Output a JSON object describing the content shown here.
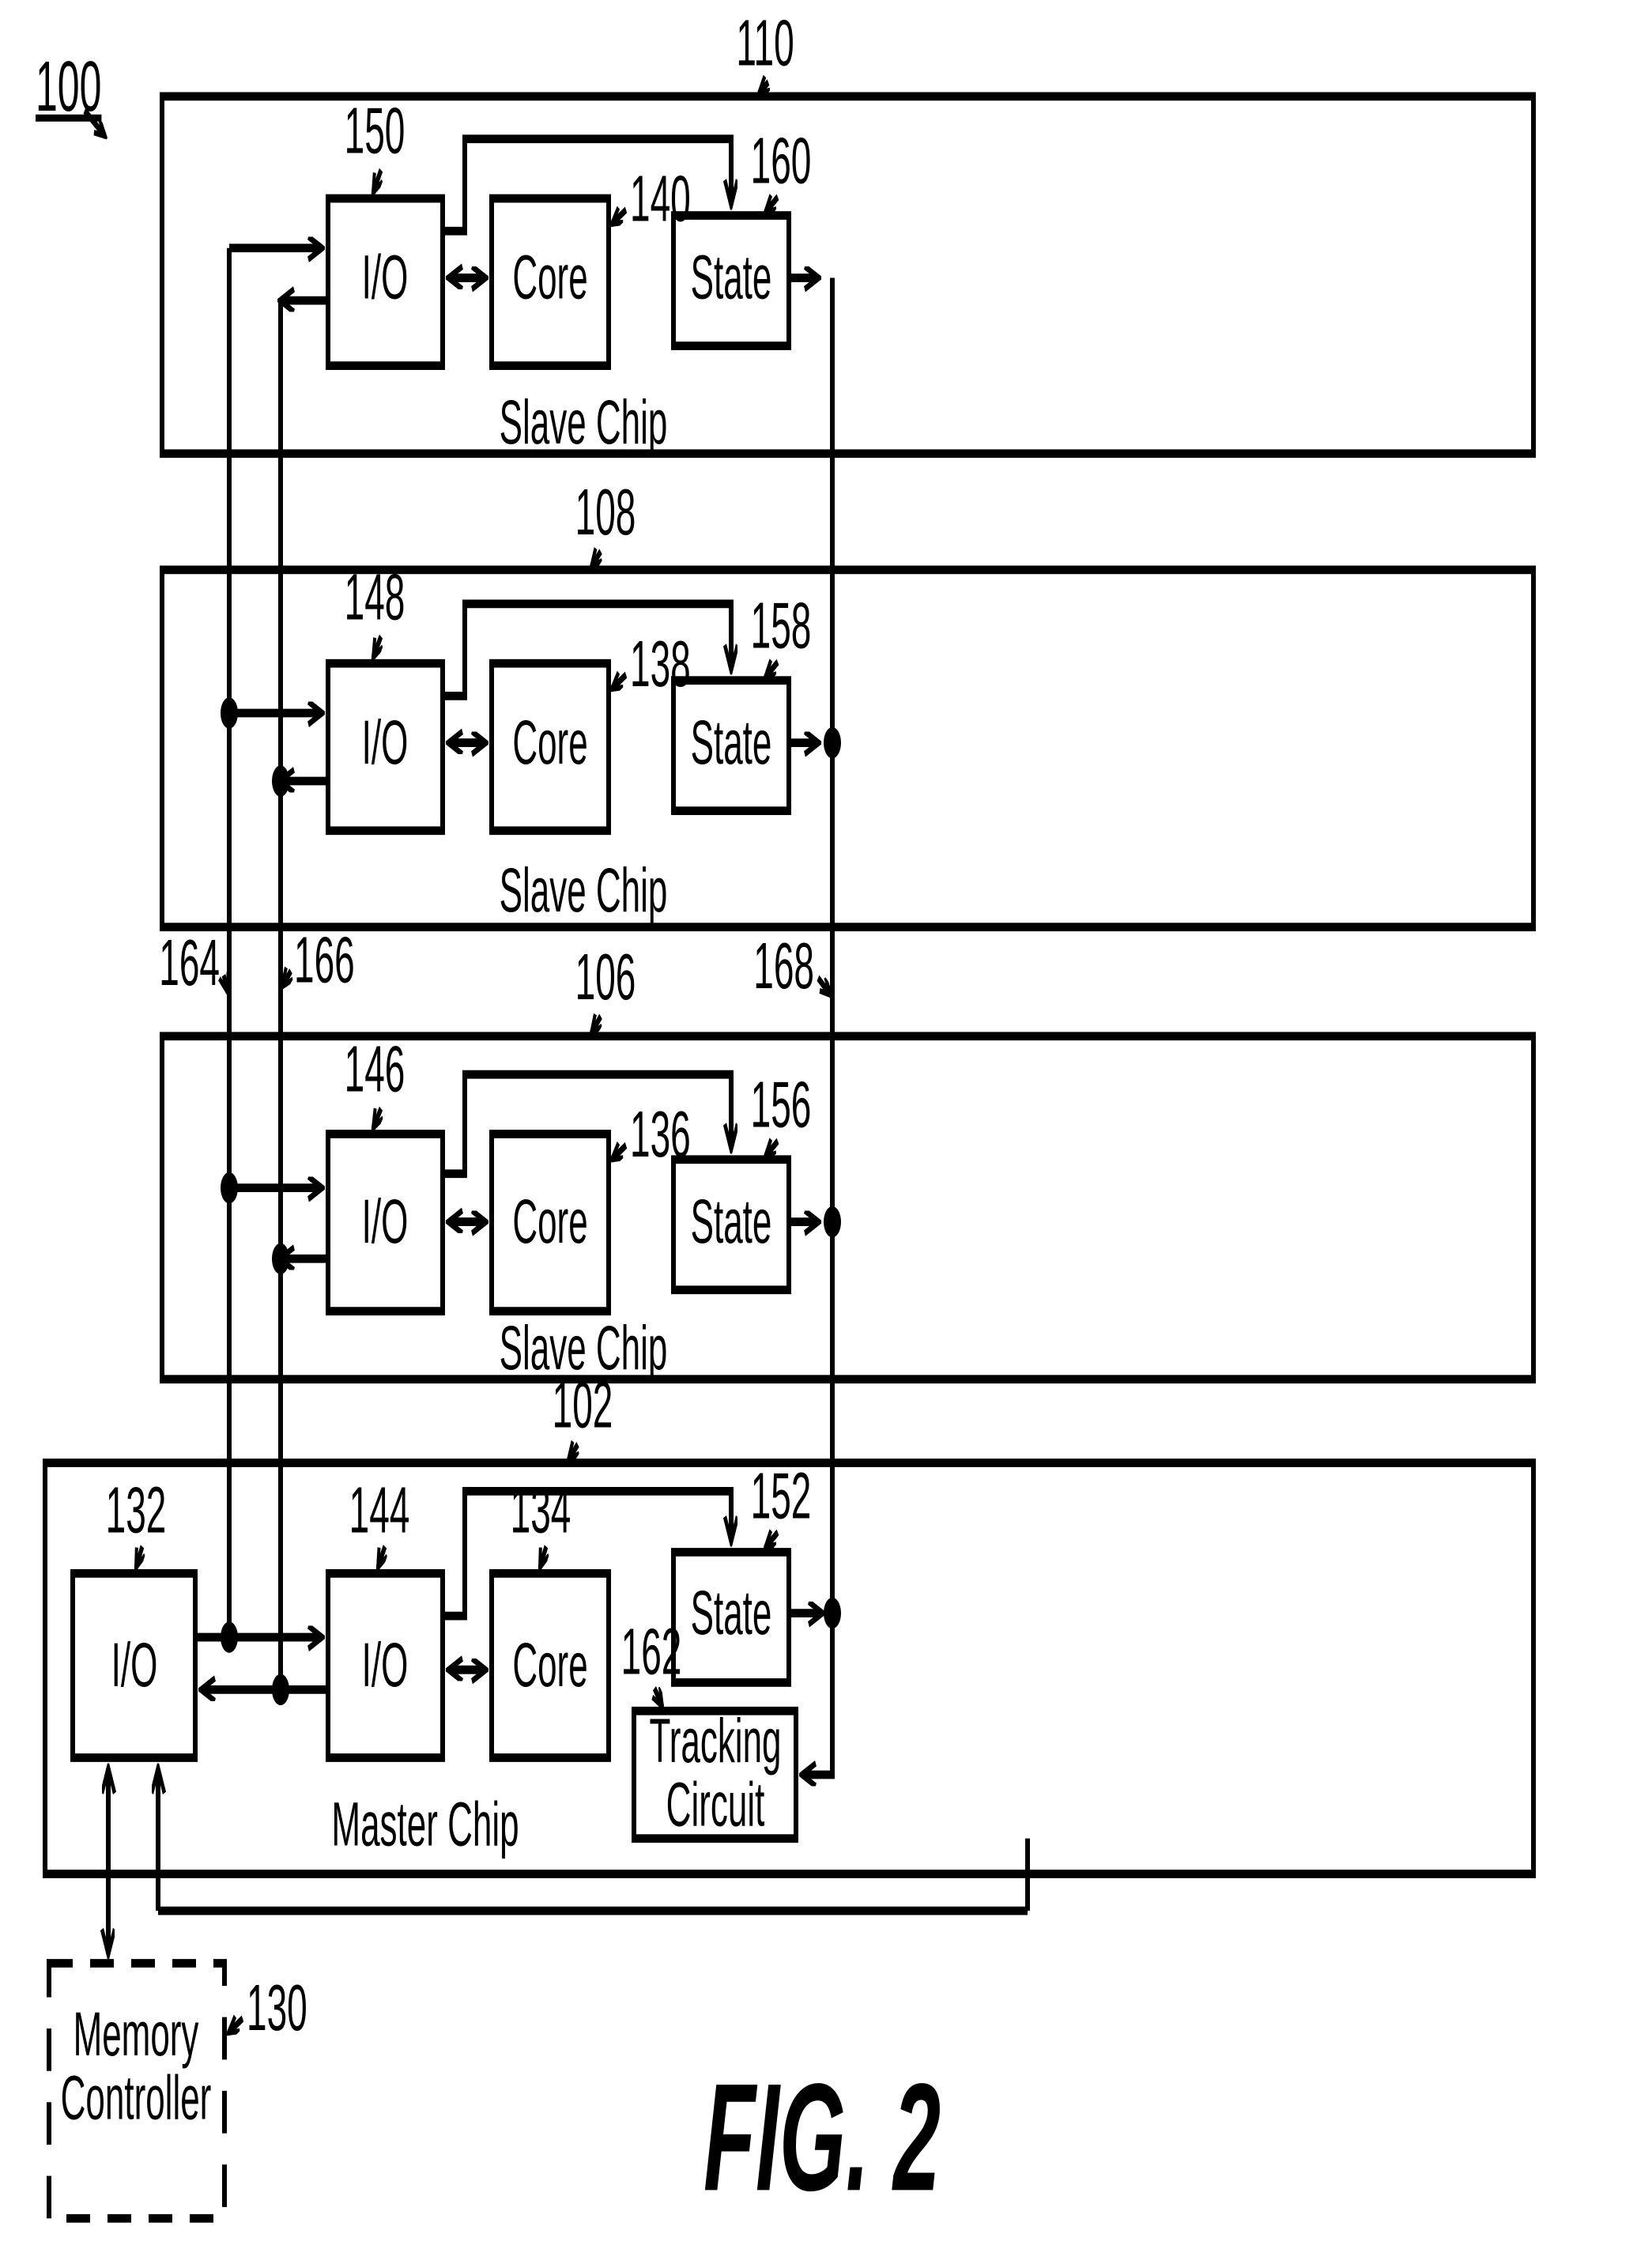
{
  "figure": {
    "caption": "FIG. 2",
    "system_ref": "100"
  },
  "chips": [
    {
      "id": "slave-top",
      "name": "Slave Chip",
      "ref": "110",
      "blocks": [
        {
          "name": "io",
          "label": "I/O",
          "ref": "150"
        },
        {
          "name": "core",
          "label": "Core",
          "ref": "140"
        },
        {
          "name": "state",
          "label": "State",
          "ref": "160"
        }
      ]
    },
    {
      "id": "slave-mid-upper",
      "name": "Slave Chip",
      "ref": "108",
      "blocks": [
        {
          "name": "io",
          "label": "I/O",
          "ref": "148"
        },
        {
          "name": "core",
          "label": "Core",
          "ref": "138"
        },
        {
          "name": "state",
          "label": "State",
          "ref": "158"
        }
      ]
    },
    {
      "id": "slave-mid-lower",
      "name": "Slave Chip",
      "ref": "106",
      "blocks": [
        {
          "name": "io",
          "label": "I/O",
          "ref": "146"
        },
        {
          "name": "core",
          "label": "Core",
          "ref": "136"
        },
        {
          "name": "state",
          "label": "State",
          "ref": "156"
        }
      ]
    },
    {
      "id": "master",
      "name": "Master Chip",
      "ref": "102",
      "blocks": [
        {
          "name": "io-external",
          "label": "I/O",
          "ref": "132"
        },
        {
          "name": "io-internal",
          "label": "I/O",
          "ref": "144"
        },
        {
          "name": "core",
          "label": "Core",
          "ref": "134"
        },
        {
          "name": "state",
          "label": "State",
          "ref": "152"
        },
        {
          "name": "tracking-circuit",
          "label_line1": "Tracking",
          "label_line2": "Circuit",
          "ref": "162"
        }
      ]
    }
  ],
  "external": {
    "memory_controller": {
      "label_line1": "Memory",
      "label_line2": "Controller",
      "ref": "130"
    }
  },
  "buses": [
    {
      "name": "command-bus-down",
      "ref": "164"
    },
    {
      "name": "reply-bus-up",
      "ref": "166"
    },
    {
      "name": "state-bus",
      "ref": "168"
    }
  ],
  "colors": {
    "line": "#000000",
    "background": "#ffffff"
  }
}
